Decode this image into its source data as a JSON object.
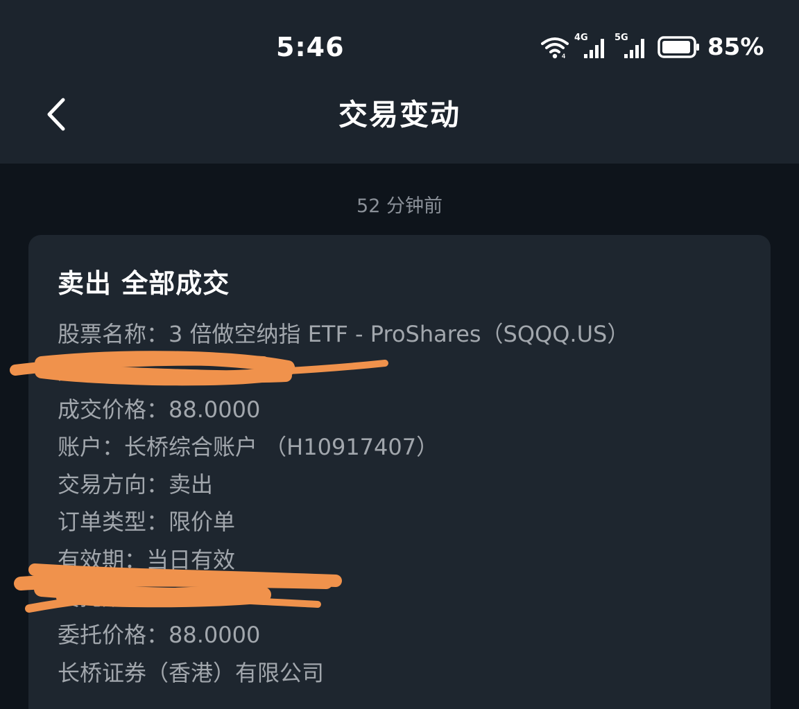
{
  "status_bar": {
    "time": "5:46",
    "network_1": "4G",
    "network_2": "5G",
    "battery_percent": "85%",
    "icons": [
      "wifi-icon",
      "cellular-4g-icon",
      "cellular-5g-icon",
      "battery-icon"
    ]
  },
  "header": {
    "back_icon": "chevron-left-icon",
    "title": "交易变动"
  },
  "notification": {
    "timestamp": "52 分钟前",
    "title": "卖出 全部成交",
    "rows": [
      "股票名称：3 倍做空纳指 ETF - ProShares（SQQQ.US）",
      "成交数",
      "成交价格：88.0000",
      "账户：长桥综合账户 （H10917407）",
      "交易方向：卖出",
      "订单类型：限价单",
      "有效期：当日有效",
      "委托数量：",
      "委托价格：88.0000",
      "长桥证券（香港）有限公司"
    ]
  },
  "colors": {
    "background": "#0e141b",
    "header_bg": "#1c242d",
    "card_bg": "#1e262f",
    "text_primary": "#ffffff",
    "text_secondary": "#a2a7ad",
    "redaction": "#f0924c"
  }
}
